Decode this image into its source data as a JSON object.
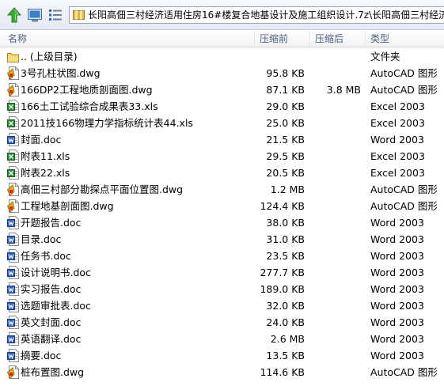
{
  "address": {
    "path": "长阳高佃三村经济适用住房16#楼复合地基设计及施工组织设计.7z\\长阳高佃三村经济"
  },
  "columns": {
    "name": "名称",
    "size": "压缩前",
    "packed": "压缩后",
    "type": "类型"
  },
  "files": [
    {
      "name": ".. (上级目录)",
      "size": "",
      "packed": "",
      "type": "文件夹",
      "icon": "folder-icon"
    },
    {
      "name": "3号孔柱状图.dwg",
      "size": "95.8 KB",
      "packed": "",
      "type": "AutoCAD 图形",
      "icon": "dwg-file-icon"
    },
    {
      "name": "166DP2工程地质剖面图.dwg",
      "size": "87.1 KB",
      "packed": "3.8 MB",
      "type": "AutoCAD 图形",
      "icon": "dwg-file-icon"
    },
    {
      "name": "166土工试验综合成果表33.xls",
      "size": "29.0 KB",
      "packed": "",
      "type": "Excel 2003",
      "icon": "excel-file-icon"
    },
    {
      "name": "2011技166物理力学指标统计表44.xls",
      "size": "25.0 KB",
      "packed": "",
      "type": "Excel 2003",
      "icon": "excel-file-icon"
    },
    {
      "name": "封面.doc",
      "size": "21.5 KB",
      "packed": "",
      "type": "Word 2003",
      "icon": "word-file-icon"
    },
    {
      "name": "附表11.xls",
      "size": "29.5 KB",
      "packed": "",
      "type": "Excel 2003",
      "icon": "excel-file-icon"
    },
    {
      "name": "附表22.xls",
      "size": "20.5 KB",
      "packed": "",
      "type": "Excel 2003",
      "icon": "excel-file-icon"
    },
    {
      "name": "高佃三村部分勘探点平面位置图.dwg",
      "size": "1.2 MB",
      "packed": "",
      "type": "AutoCAD 图形",
      "icon": "dwg-file-icon"
    },
    {
      "name": "工程地基剖面图.dwg",
      "size": "124.4 KB",
      "packed": "",
      "type": "AutoCAD 图形",
      "icon": "dwg-file-icon"
    },
    {
      "name": "开题报告.doc",
      "size": "38.0 KB",
      "packed": "",
      "type": "Word 2003",
      "icon": "word-file-icon"
    },
    {
      "name": "目录.doc",
      "size": "31.0 KB",
      "packed": "",
      "type": "Word 2003",
      "icon": "word-file-icon"
    },
    {
      "name": "任务书.doc",
      "size": "23.5 KB",
      "packed": "",
      "type": "Word 2003",
      "icon": "word-file-icon"
    },
    {
      "name": "设计说明书.doc",
      "size": "277.7 KB",
      "packed": "",
      "type": "Word 2003",
      "icon": "word-file-icon"
    },
    {
      "name": "实习报告.doc",
      "size": "189.0 KB",
      "packed": "",
      "type": "Word 2003",
      "icon": "word-file-icon"
    },
    {
      "name": "选题审批表.doc",
      "size": "32.0 KB",
      "packed": "",
      "type": "Word 2003",
      "icon": "word-file-icon"
    },
    {
      "name": "英文封面.doc",
      "size": "24.0 KB",
      "packed": "",
      "type": "Word 2003",
      "icon": "word-file-icon"
    },
    {
      "name": "英语翻译.doc",
      "size": "2.6 MB",
      "packed": "",
      "type": "Word 2003",
      "icon": "word-file-icon"
    },
    {
      "name": "摘要.doc",
      "size": "13.5 KB",
      "packed": "",
      "type": "Word 2003",
      "icon": "word-file-icon"
    },
    {
      "name": "桩布置图.dwg",
      "size": "114.6 KB",
      "packed": "",
      "type": "AutoCAD 图形",
      "icon": "dwg-file-icon"
    }
  ]
}
